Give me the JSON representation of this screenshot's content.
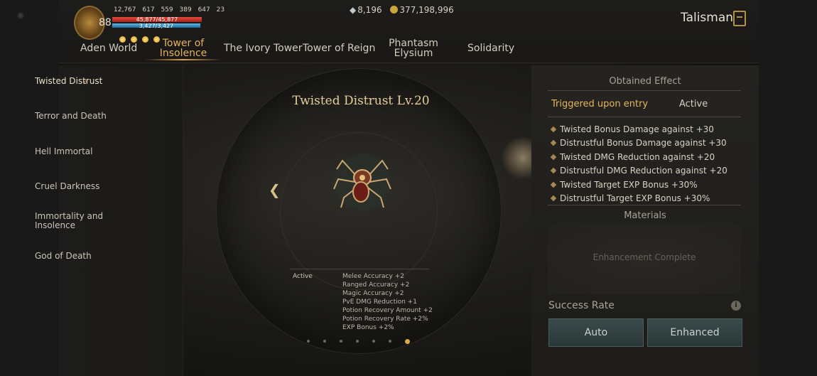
{
  "header": {
    "level": "88",
    "stats": [
      "12,767",
      "617",
      "559",
      "389",
      "647",
      "23"
    ],
    "hp_text": "45,877/45,877",
    "mp_text": "3,427/3,427",
    "hp_fraction": 1.0,
    "mp_fraction": 1.0,
    "orb_count": 4,
    "currency": {
      "gem": "8,196",
      "gold": "377,198,996"
    },
    "title": "Talisman"
  },
  "tabs": [
    {
      "label": "Aden World"
    },
    {
      "label": "Tower of Insolence"
    },
    {
      "label": "The Ivory Tower"
    },
    {
      "label": "Tower of Reign"
    },
    {
      "label": "Phantasm Elysium"
    },
    {
      "label": "Solidarity"
    }
  ],
  "menu": [
    {
      "label": "Twisted Distrust"
    },
    {
      "label": "Terror and Death"
    },
    {
      "label": "Hell Immortal"
    },
    {
      "label": "Cruel Darkness"
    },
    {
      "label": "Immortality and Insolence"
    },
    {
      "label": "God of Death"
    }
  ],
  "center": {
    "title": "Twisted Distrust Lv.20",
    "active_label": "Active",
    "effects": [
      "Melee Accuracy +2",
      "Ranged Accuracy +2",
      "Magic Accuracy +2",
      "PvE DMG Reduction +1",
      "Potion Recovery Amount +2",
      "Potion Recovery Rate +2%",
      "EXP Bonus +2%"
    ],
    "page_count": 7,
    "current_page": 7
  },
  "panel": {
    "obtained_title": "Obtained Effect",
    "tab_triggered": "Triggered upon entry",
    "tab_active": "Active",
    "effects": [
      "Twisted Bonus Damage against +30",
      "Distrustful Bonus Damage against +30",
      "Twisted DMG Reduction against +20",
      "Distrustful DMG Reduction against +20",
      "Twisted Target EXP Bonus +30%",
      "Distrustful Target EXP Bonus +30%"
    ],
    "materials_title": "Materials",
    "materials_status": "Enhancement Complete",
    "success_label": "Success Rate",
    "info_glyph": "i",
    "auto_label": "Auto",
    "enhanced_label": "Enhanced"
  },
  "colors": {
    "accent": "#e3b25c",
    "hp": "#c8302a",
    "mp": "#3d93c4",
    "button": "#34434a"
  }
}
